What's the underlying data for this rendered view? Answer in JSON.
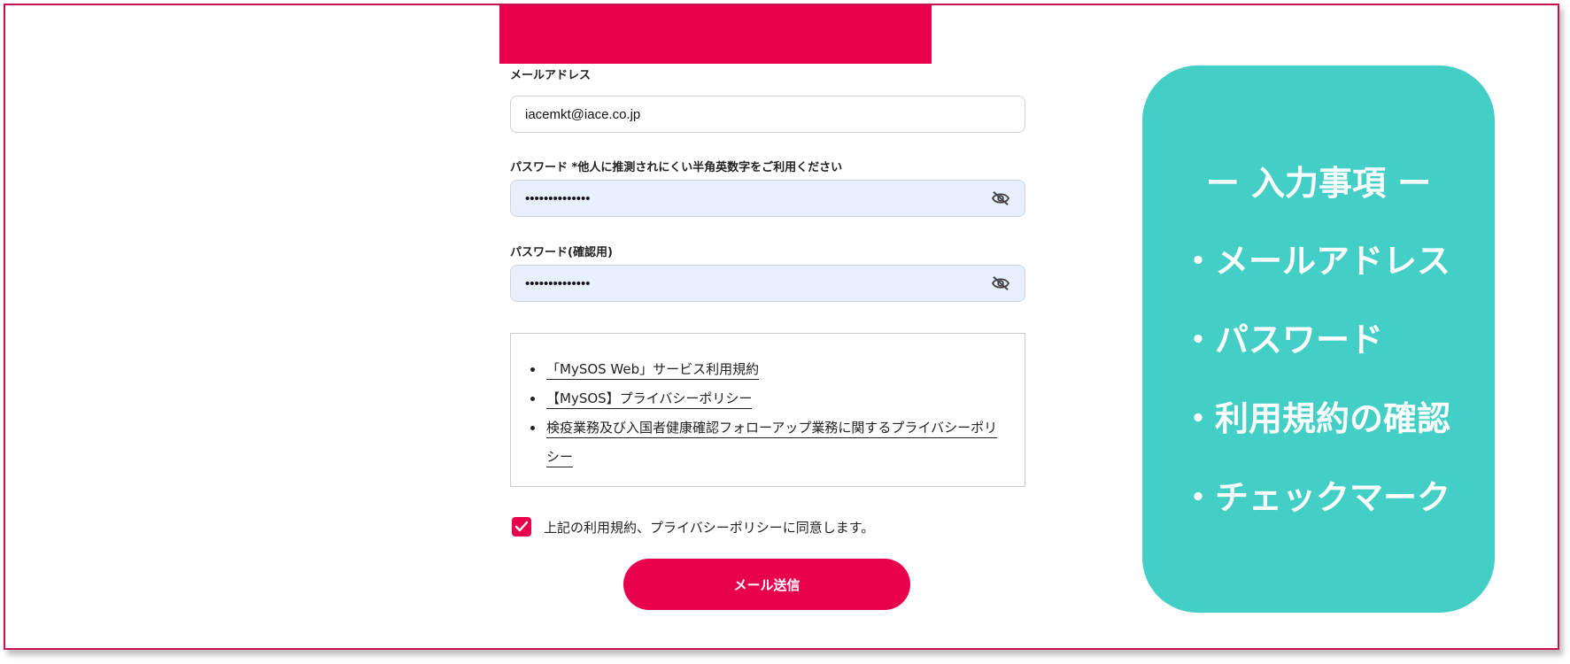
{
  "form": {
    "email_label": "メールアドレス",
    "email_value": "iacemkt@iace.co.jp",
    "password_label": "パスワード *他人に推測されにくい半角英数字をご利用ください",
    "password_value": "••••••••••••••",
    "confirm_label": "パスワード(確認用)",
    "confirm_value": "••••••••••••••",
    "terms_links": [
      "「MySOS Web」サービス利用規約",
      "【MySOS】プライバシーポリシー",
      "検疫業務及び入国者健康確認フォローアップ業務に関するプライバシーポリシー"
    ],
    "agree_text": "上記の利用規約、プライバシーポリシーに同意します。",
    "agree_checked": true,
    "submit_label": "メール送信"
  },
  "panel": {
    "title": "ー 入力事項 ー",
    "items": [
      "・メールアドレス",
      "・パスワード",
      "・利用規約の確認",
      "・チェックマーク"
    ]
  },
  "colors": {
    "brand": "#e8004c",
    "panel": "#43cfc5",
    "autofill": "#e8f0fe"
  },
  "icons": {
    "password_toggle": "eye-slash-icon",
    "checkbox": "checkmark-icon"
  }
}
